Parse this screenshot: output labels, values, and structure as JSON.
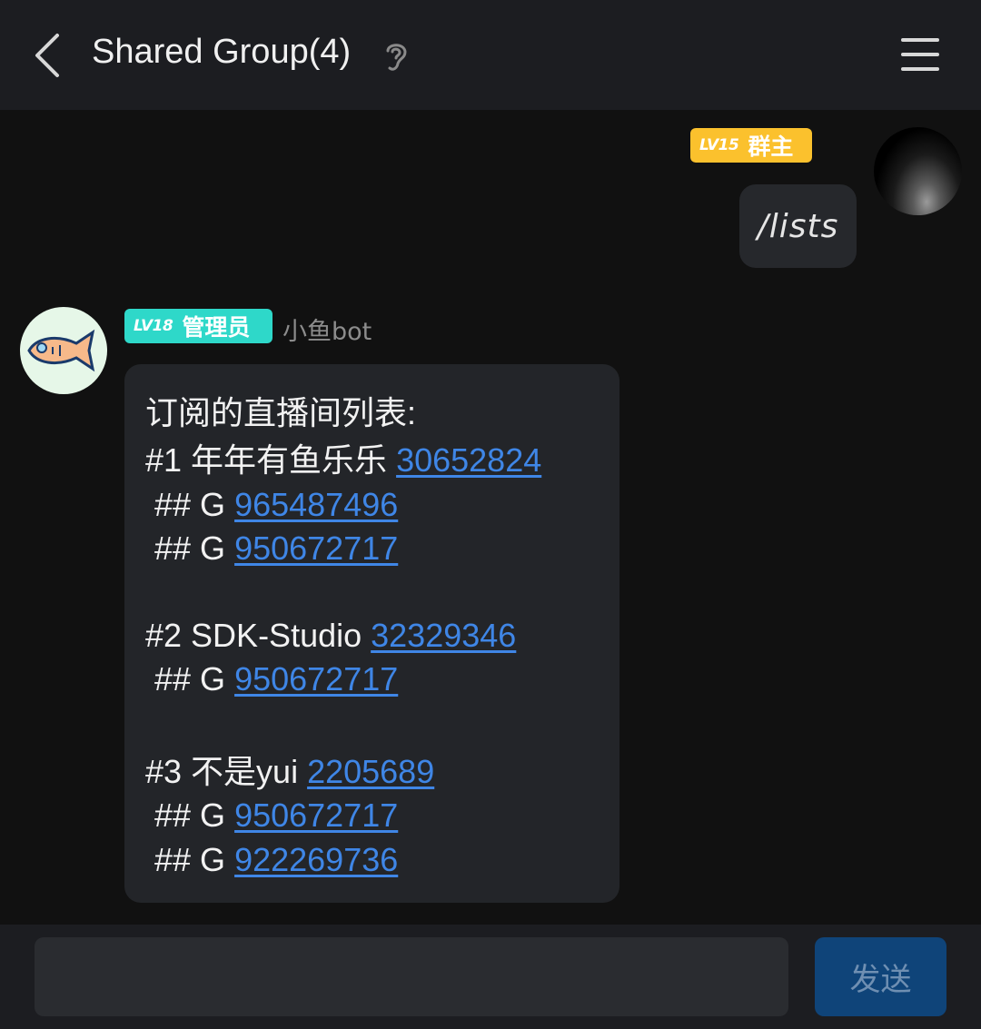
{
  "header": {
    "title": "Shared Group(4)",
    "icons": {
      "back": "chevron-left-icon",
      "ear": "ear-icon",
      "menu": "hamburger-menu-icon"
    }
  },
  "messages": {
    "self": {
      "level": "LV15",
      "role": "群主",
      "text": "/lists",
      "badge_color": "#fbc12d"
    },
    "bot": {
      "level": "LV18",
      "role": "管理员",
      "name": "小鱼bot",
      "badge_color": "#2ed8c9",
      "heading": "订阅的直播间列表:",
      "rooms": [
        {
          "prefix": "#1 年年有鱼乐乐 ",
          "room_id": "30652824",
          "groups": [
            "965487496",
            "950672717"
          ]
        },
        {
          "prefix": "#2 SDK-Studio ",
          "room_id": "32329346",
          "groups": [
            "950672717"
          ]
        },
        {
          "prefix": "#3 不是yui ",
          "room_id": "2205689",
          "groups": [
            "950672717",
            "922269736"
          ]
        }
      ],
      "group_prefix": " ## G "
    }
  },
  "composer": {
    "input_value": "",
    "input_placeholder": "",
    "send_label": "发送"
  },
  "colors": {
    "link": "#3f86e6",
    "background": "#111111",
    "send_button": "#0f4479"
  }
}
